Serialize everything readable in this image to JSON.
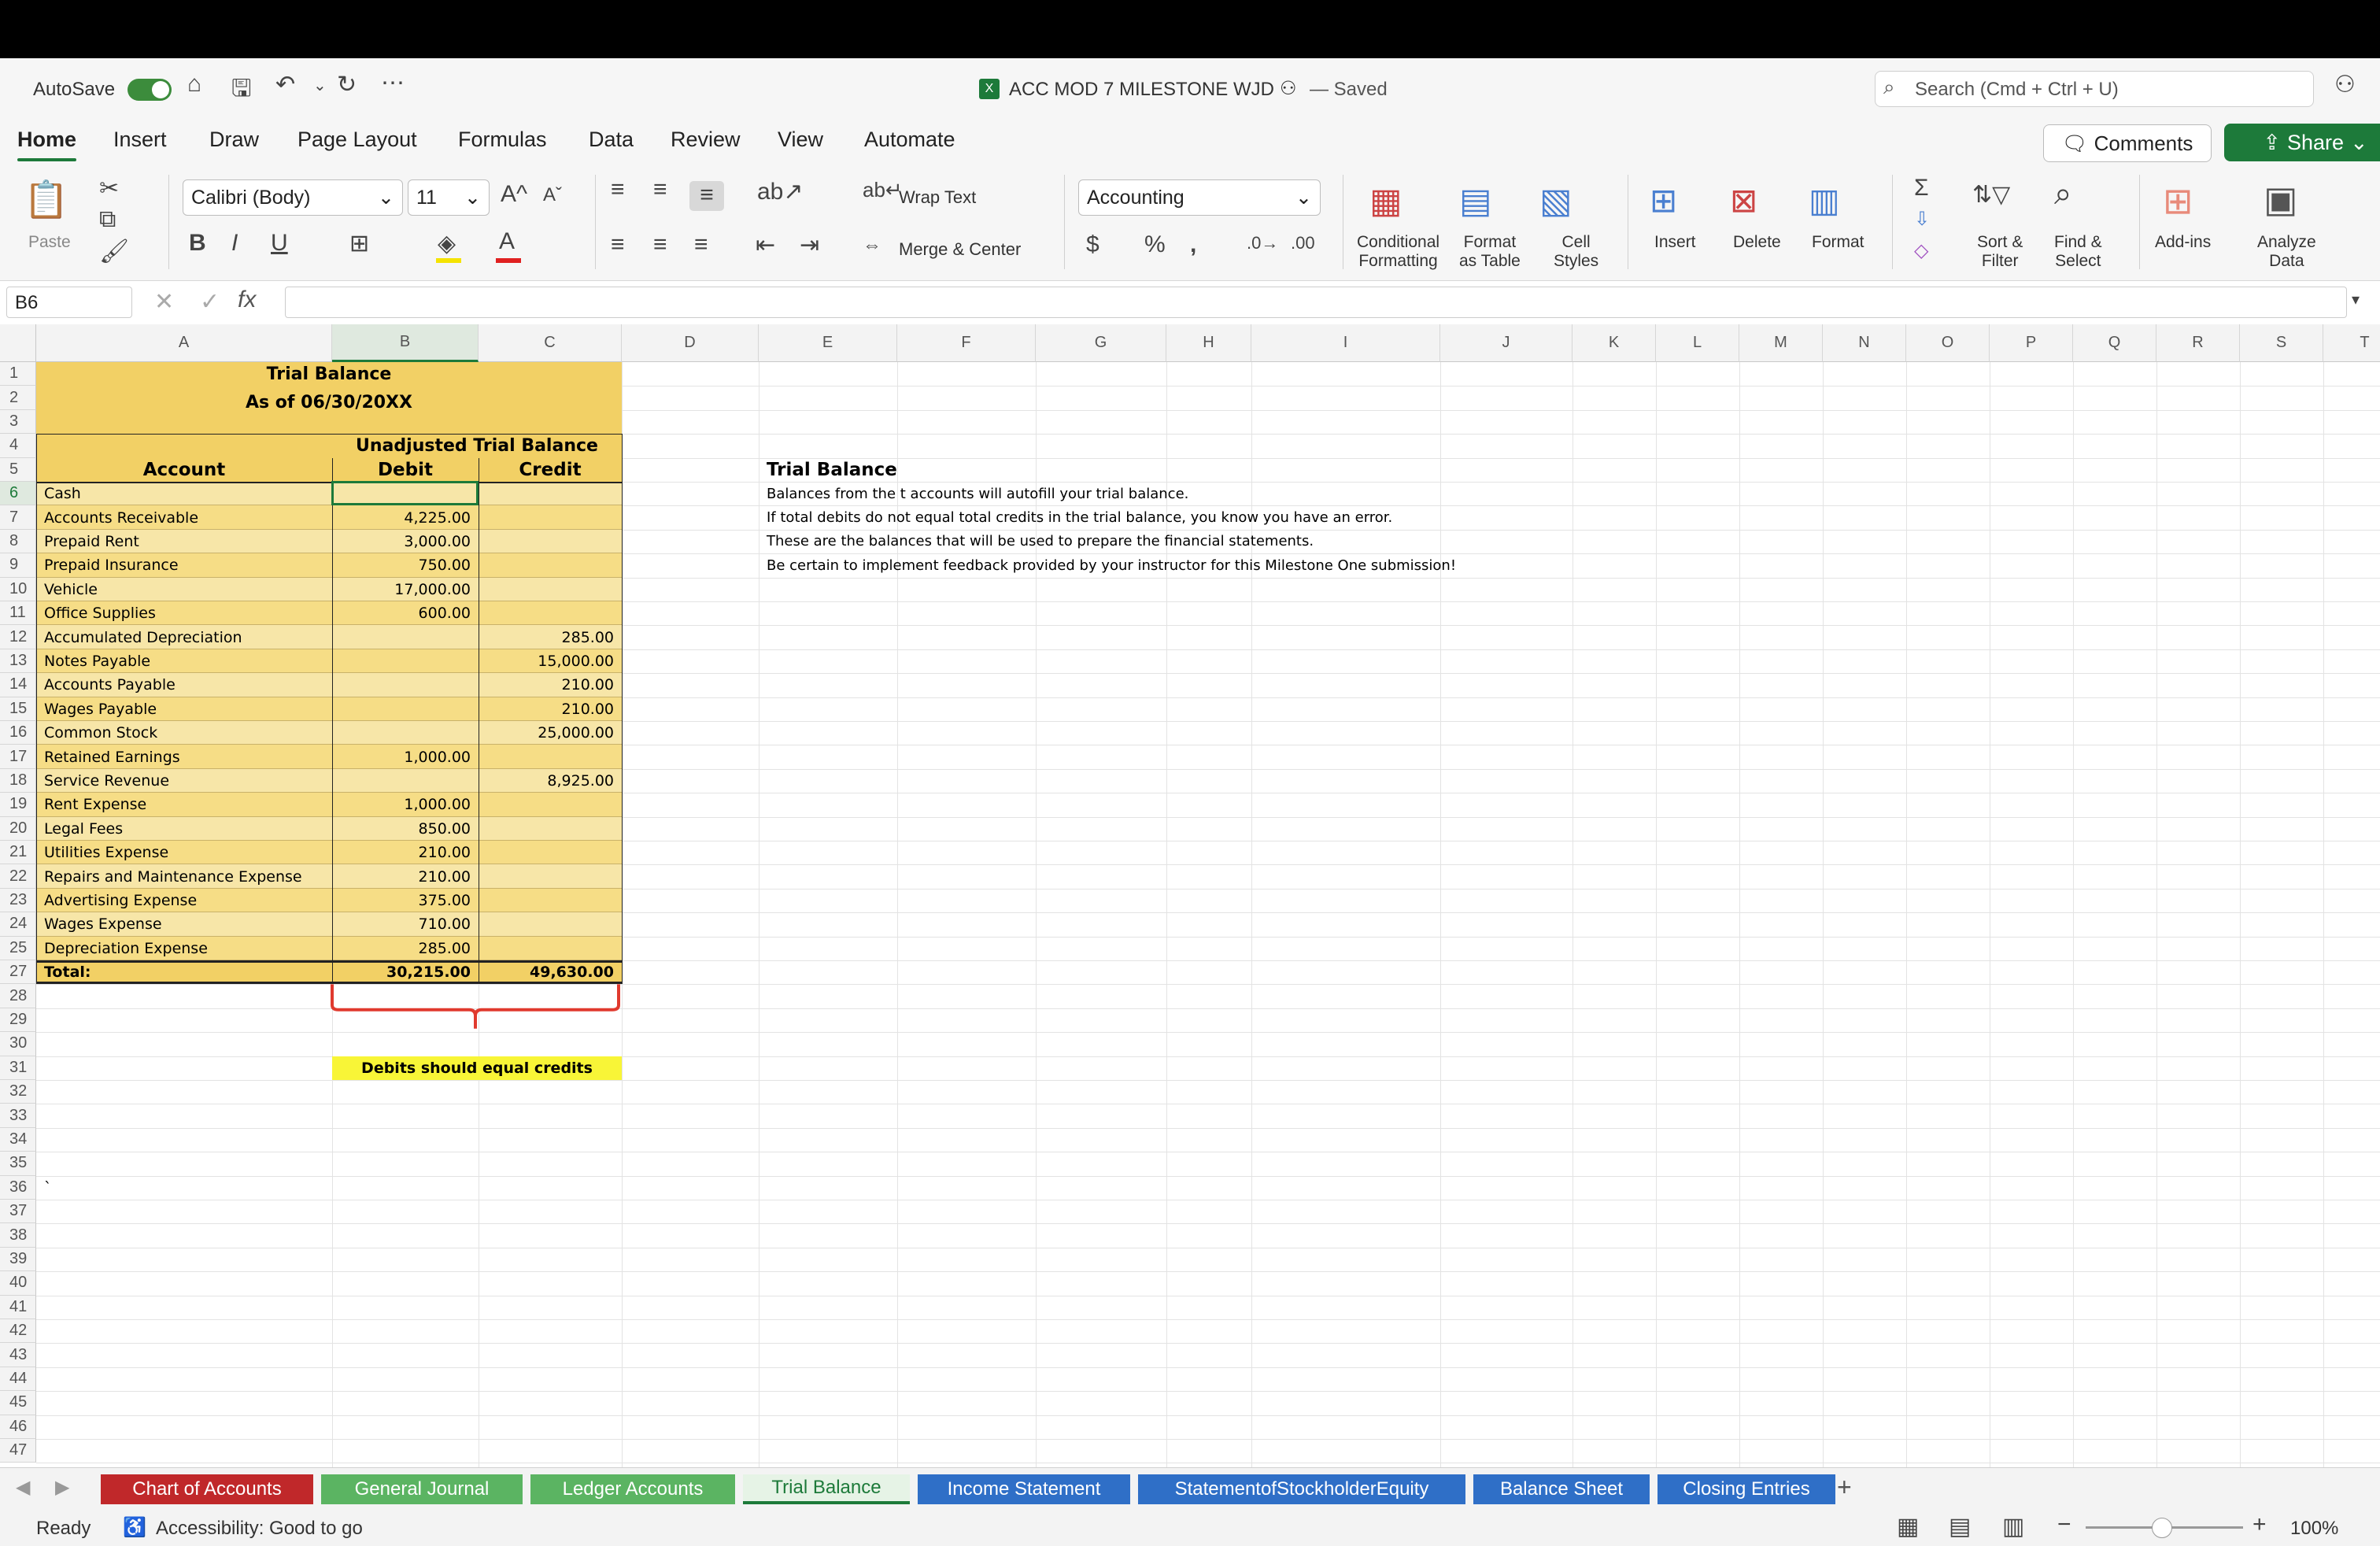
{
  "app": {
    "autosave_label": "AutoSave",
    "title": "ACC MOD 7 MILESTONE WJD",
    "saved": "— Saved",
    "search_placeholder": "Search (Cmd + Ctrl + U)"
  },
  "ribbon_tabs": [
    "Home",
    "Insert",
    "Draw",
    "Page Layout",
    "Formulas",
    "Data",
    "Review",
    "View",
    "Automate"
  ],
  "buttons": {
    "comments": "Comments",
    "share": "Share"
  },
  "ribbon": {
    "paste": "Paste",
    "font": "Calibri (Body)",
    "size": "11",
    "wrap_text": "Wrap Text",
    "merge_center": "Merge & Center",
    "number_format": "Accounting",
    "conditional_formatting": [
      "Conditional",
      "Formatting"
    ],
    "format_as_table": [
      "Format",
      "as Table"
    ],
    "cell_styles": [
      "Cell",
      "Styles"
    ],
    "insert": "Insert",
    "delete": "Delete",
    "format": "Format",
    "sort_filter": [
      "Sort &",
      "Filter"
    ],
    "find_select": [
      "Find &",
      "Select"
    ],
    "addins": "Add-ins",
    "analyze": [
      "Analyze",
      "Data"
    ]
  },
  "formula_bar": {
    "name_box": "B6",
    "value": ""
  },
  "columns": [
    "A",
    "B",
    "C",
    "D",
    "E",
    "F",
    "G",
    "H",
    "I",
    "J",
    "K",
    "L",
    "M",
    "N",
    "O",
    "P",
    "Q",
    "R",
    "S",
    "T"
  ],
  "rows": [
    "1",
    "2",
    "3",
    "4",
    "5",
    "6",
    "7",
    "8",
    "9",
    "10",
    "11",
    "12",
    "13",
    "14",
    "15",
    "16",
    "17",
    "18",
    "19",
    "20",
    "21",
    "22",
    "23",
    "24",
    "25",
    "27",
    "28",
    "29",
    "30",
    "31",
    "32",
    "33",
    "34",
    "35",
    "36",
    "37",
    "38",
    "39",
    "40",
    "41",
    "42",
    "43",
    "44",
    "45",
    "46",
    "47"
  ],
  "sheet": {
    "title": "Trial Balance",
    "subtitle": "As of 06/30/20XX",
    "section": "Unadjusted Trial Balance",
    "headers": {
      "account": "Account",
      "debit": "Debit",
      "credit": "Credit"
    },
    "accounts": [
      {
        "name": "Cash",
        "debit": "",
        "credit": ""
      },
      {
        "name": "Accounts Receivable",
        "debit": "4,225.00",
        "credit": ""
      },
      {
        "name": "Prepaid Rent",
        "debit": "3,000.00",
        "credit": ""
      },
      {
        "name": "Prepaid Insurance",
        "debit": "750.00",
        "credit": ""
      },
      {
        "name": "Vehicle",
        "debit": "17,000.00",
        "credit": ""
      },
      {
        "name": "Office Supplies",
        "debit": "600.00",
        "credit": ""
      },
      {
        "name": "Accumulated Depreciation",
        "debit": "",
        "credit": "285.00"
      },
      {
        "name": "Notes Payable",
        "debit": "",
        "credit": "15,000.00"
      },
      {
        "name": "Accounts Payable",
        "debit": "",
        "credit": "210.00"
      },
      {
        "name": "Wages Payable",
        "debit": "",
        "credit": "210.00"
      },
      {
        "name": "Common Stock",
        "debit": "",
        "credit": "25,000.00"
      },
      {
        "name": "Retained Earnings",
        "debit": "1,000.00",
        "credit": ""
      },
      {
        "name": "Service Revenue",
        "debit": "",
        "credit": "8,925.00"
      },
      {
        "name": "Rent Expense",
        "debit": "1,000.00",
        "credit": ""
      },
      {
        "name": "Legal Fees",
        "debit": "850.00",
        "credit": ""
      },
      {
        "name": "Utilities Expense",
        "debit": "210.00",
        "credit": ""
      },
      {
        "name": "Repairs and Maintenance Expense",
        "debit": "210.00",
        "credit": ""
      },
      {
        "name": "Advertising Expense",
        "debit": "375.00",
        "credit": ""
      },
      {
        "name": "Wages Expense",
        "debit": "710.00",
        "credit": ""
      },
      {
        "name": "Depreciation Expense",
        "debit": "285.00",
        "credit": ""
      }
    ],
    "total": {
      "label": "Total:",
      "debit": "30,215.00",
      "credit": "49,630.00"
    },
    "note": "Debits should equal credits",
    "tick_a36": "`",
    "instructions": {
      "title": "Trial Balance",
      "lines": [
        "Balances from the t accounts will autofill your trial balance.",
        "If total debits do not equal total credits in the trial balance, you know you have an error.",
        "These are the balances that will be used to prepare the financial statements.",
        "Be certain to implement feedback provided by your instructor for this Milestone One submission!"
      ]
    }
  },
  "sheet_tabs": [
    {
      "label": "Chart of Accounts",
      "color": "#c0282a"
    },
    {
      "label": "General Journal",
      "color": "#5bb462"
    },
    {
      "label": "Ledger Accounts",
      "color": "#5bb462"
    },
    {
      "label": "Trial Balance",
      "color": "#e6f3e6"
    },
    {
      "label": "Income Statement",
      "color": "#2f6fc7"
    },
    {
      "label": "StatementofStockholderEquity",
      "color": "#2f6fc7"
    },
    {
      "label": "Balance Sheet",
      "color": "#2f6fc7"
    },
    {
      "label": "Closing Entries",
      "color": "#2f6fc7"
    }
  ],
  "status": {
    "ready": "Ready",
    "accessibility": "Accessibility: Good to go",
    "zoom": "100%"
  }
}
